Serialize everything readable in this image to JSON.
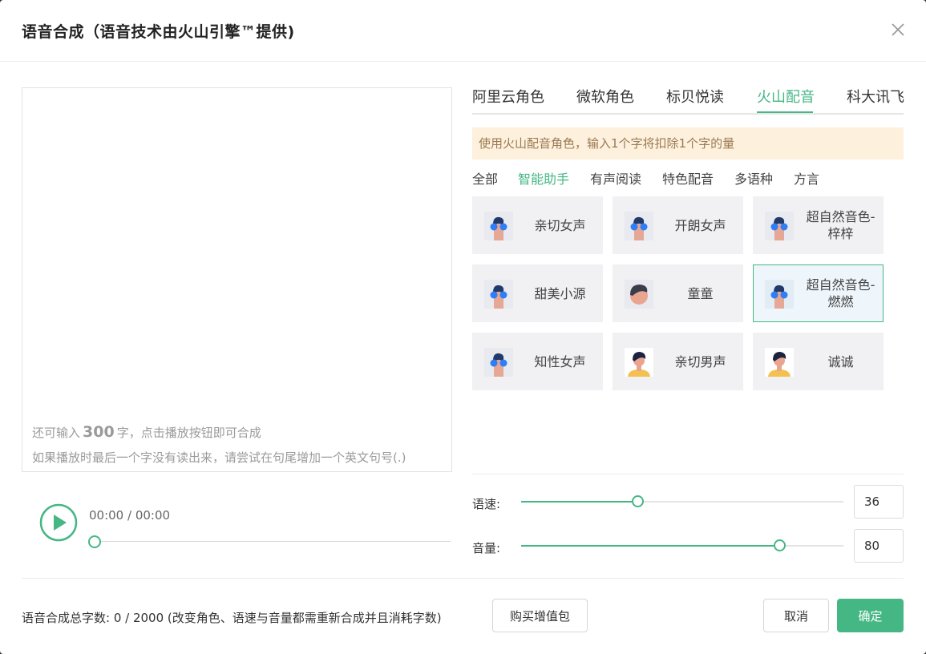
{
  "dialog": {
    "title": "语音合成（语音技术由火山引擎™提供)",
    "close_icon": "close-icon"
  },
  "editor": {
    "hint_prefix": "还可输入",
    "hint_count": "300",
    "hint_suffix": "字，点击播放按钮即可合成",
    "hint_line2": "如果播放时最后一个字没有读出来，请尝试在句尾增加一个英文句号(.)"
  },
  "player": {
    "play_icon": "play-icon",
    "time": "00:00 / 00:00",
    "progress": 0
  },
  "tabs": [
    {
      "label": "阿里云角色",
      "active": false
    },
    {
      "label": "微软角色",
      "active": false
    },
    {
      "label": "标贝悦读",
      "active": false
    },
    {
      "label": "火山配音",
      "active": true
    },
    {
      "label": "科大讯飞",
      "active": false
    }
  ],
  "notice": "使用火山配音角色，输入1个字将扣除1个字的量",
  "categories": [
    {
      "label": "全部",
      "active": false
    },
    {
      "label": "智能助手",
      "active": true
    },
    {
      "label": "有声阅读",
      "active": false
    },
    {
      "label": "特色配音",
      "active": false
    },
    {
      "label": "多语种",
      "active": false
    },
    {
      "label": "方言",
      "active": false
    }
  ],
  "voices": [
    {
      "label": "亲切女声",
      "avatar": "female-avatar-icon",
      "selected": false
    },
    {
      "label": "开朗女声",
      "avatar": "female-avatar-icon",
      "selected": false
    },
    {
      "label": "超自然音色-梓梓",
      "avatar": "female-avatar-icon",
      "selected": false
    },
    {
      "label": "甜美小源",
      "avatar": "female-avatar-icon",
      "selected": false
    },
    {
      "label": "童童",
      "avatar": "child-avatar-icon",
      "selected": false
    },
    {
      "label": "超自然音色-燃燃",
      "avatar": "female-avatar-icon",
      "selected": true
    },
    {
      "label": "知性女声",
      "avatar": "female-avatar-icon",
      "selected": false
    },
    {
      "label": "亲切男声",
      "avatar": "male-avatar-icon",
      "selected": false
    },
    {
      "label": "诚诚",
      "avatar": "male-avatar-icon",
      "selected": false
    }
  ],
  "speed": {
    "label": "语速:",
    "value": "36",
    "level": 0.36
  },
  "volume": {
    "label": "音量:",
    "value": "80",
    "level": 0.8
  },
  "footer": {
    "summary": "语音合成总字数:  0 / 2000  (改变角色、语速与音量都需重新合成并且消耗字数)",
    "buy_label": "购买增值包",
    "cancel_label": "取消",
    "confirm_label": "确定"
  },
  "colors": {
    "accent": "#45b785",
    "notice_bg": "#fdf0dd",
    "notice_text": "#9a7a52"
  }
}
